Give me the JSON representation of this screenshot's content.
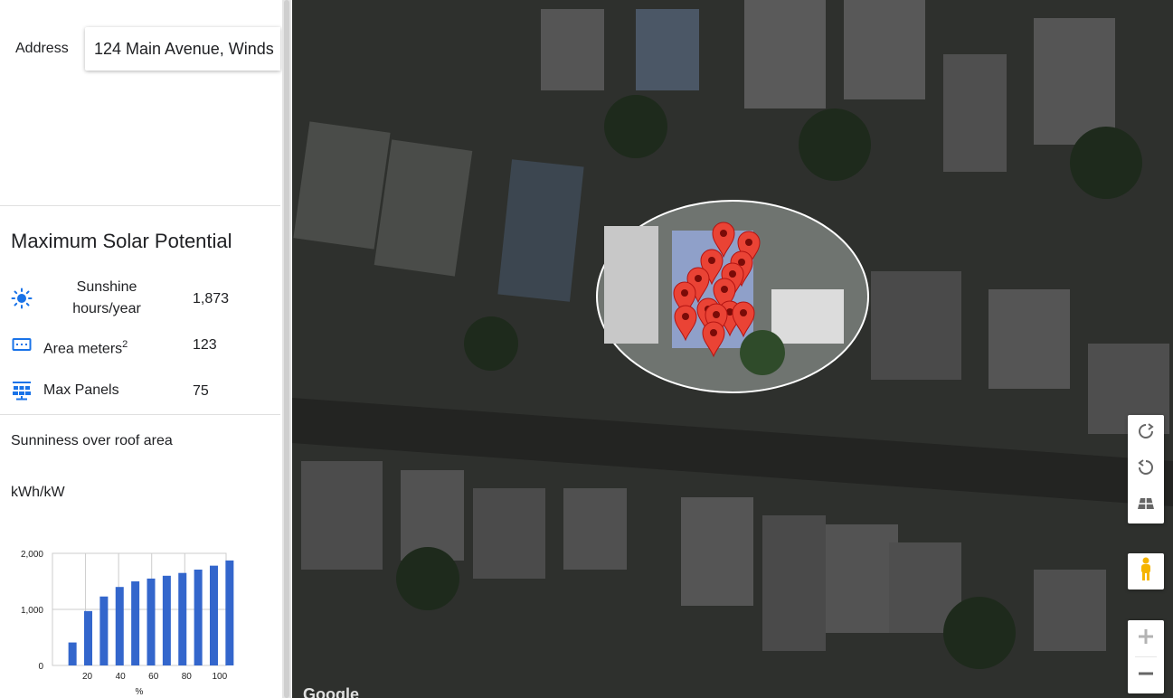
{
  "address": {
    "label": "Address",
    "value": "124 Main Avenue, Winds"
  },
  "summary": {
    "title": "Maximum Solar Potential",
    "stats": [
      {
        "icon": "sun-icon",
        "label": "Sunshine hours/year",
        "value": "1,873"
      },
      {
        "icon": "area-icon",
        "label": "Area meters",
        "label_sup": "2",
        "value": "123"
      },
      {
        "icon": "solar-panel-icon",
        "label": "Max Panels",
        "value": "75"
      }
    ]
  },
  "sunniness": {
    "title": "Sunniness over roof area",
    "unit": "kWh/kW"
  },
  "chart_data": {
    "type": "bar",
    "x": [
      10,
      20,
      30,
      40,
      50,
      60,
      70,
      80,
      90,
      100
    ],
    "values": [
      410,
      970,
      1230,
      1400,
      1500,
      1550,
      1600,
      1650,
      1710,
      1780,
      1873
    ],
    "x_values": [
      5,
      14.5,
      24,
      33.5,
      43,
      52.5,
      62,
      71.5,
      81,
      90.5,
      100
    ],
    "xticks": [
      "20",
      "40",
      "60",
      "80",
      "100"
    ],
    "yticks": [
      "0",
      "1,000",
      "2,000"
    ],
    "xlabel": "%",
    "ylabel": "",
    "ylim": [
      0,
      2000
    ],
    "color": "#3366cc"
  },
  "map": {
    "attribution": "Google",
    "controls": [
      "rotate-clockwise-icon",
      "rotate-counterclockwise-icon",
      "tilt-icon",
      "pegman-icon",
      "zoom-in-icon",
      "zoom-out-icon"
    ],
    "marker_color": "#ea4335"
  }
}
